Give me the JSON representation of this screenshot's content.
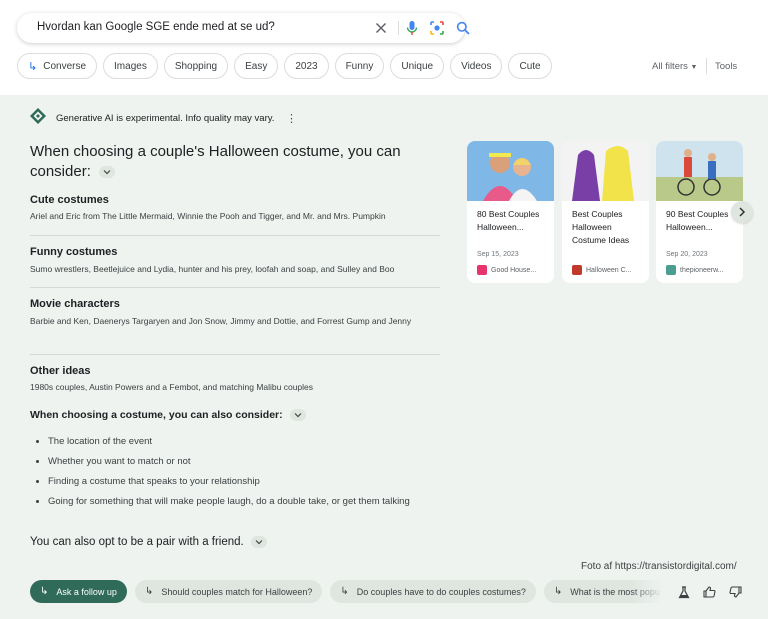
{
  "search": {
    "query": "Hvordan kan Google SGE ende med at se ud?",
    "icons": [
      "close-icon",
      "mic-icon",
      "lens-icon",
      "search-icon"
    ]
  },
  "chips": [
    "Converse",
    "Images",
    "Shopping",
    "Easy",
    "2023",
    "Funny",
    "Unique",
    "Videos",
    "Cute"
  ],
  "toolbar": {
    "all_filters": "All filters",
    "tools": "Tools"
  },
  "sge": {
    "experimental_note": "Generative AI is experimental. Info quality may vary.",
    "heading": "When choosing a couple's Halloween costume, you can consider:",
    "sections": [
      {
        "title": "Cute costumes",
        "body": "Ariel and Eric from The Little Mermaid, Winnie the Pooh and Tigger, and Mr. and Mrs. Pumpkin"
      },
      {
        "title": "Funny costumes",
        "body": "Sumo wrestlers, Beetlejuice and Lydia, hunter and his prey, loofah and soap, and Sulley and Boo"
      },
      {
        "title": "Movie characters",
        "body": "Barbie and Ken, Daenerys Targaryen and Jon Snow, Jimmy and Dottie, and Forrest Gump and Jenny"
      },
      {
        "title": "Other ideas",
        "body": "1980s couples, Austin Powers and a Fembot, and matching Malibu couples"
      }
    ],
    "also_title": "When choosing a costume, you can also consider:",
    "bullets": [
      "The location of the event",
      "Whether you want to match or not",
      "Finding a costume that speaks to your relationship",
      "Going for something that will make people laugh, do a double take, or get them talking"
    ],
    "pair_text": "You can also opt to be a pair with a friend."
  },
  "cards": [
    {
      "title": "80 Best Couples Halloween...",
      "date": "Sep 15, 2023",
      "source": "Good House...",
      "fav_color": "#e8336d",
      "fav_text": "GH"
    },
    {
      "title": "Best Couples Halloween Costume Ideas",
      "date": "",
      "source": "Halloween C...",
      "fav_color": "#c0392b",
      "fav_text": "HC"
    },
    {
      "title": "90 Best Couples Halloween...",
      "date": "Sep 20, 2023",
      "source": "thepioneerw...",
      "fav_color": "#4a9d8f",
      "fav_text": ""
    }
  ],
  "credit": "Foto af https://transistordigital.com/",
  "followups": [
    "Ask a follow up",
    "Should couples match for Halloween?",
    "Do couples have to do couples costumes?",
    "What is the most popu"
  ],
  "colors": {
    "accent_green": "#2f6b58",
    "panel_bg": "#eef3ef",
    "link_blue": "#1a73e8"
  }
}
